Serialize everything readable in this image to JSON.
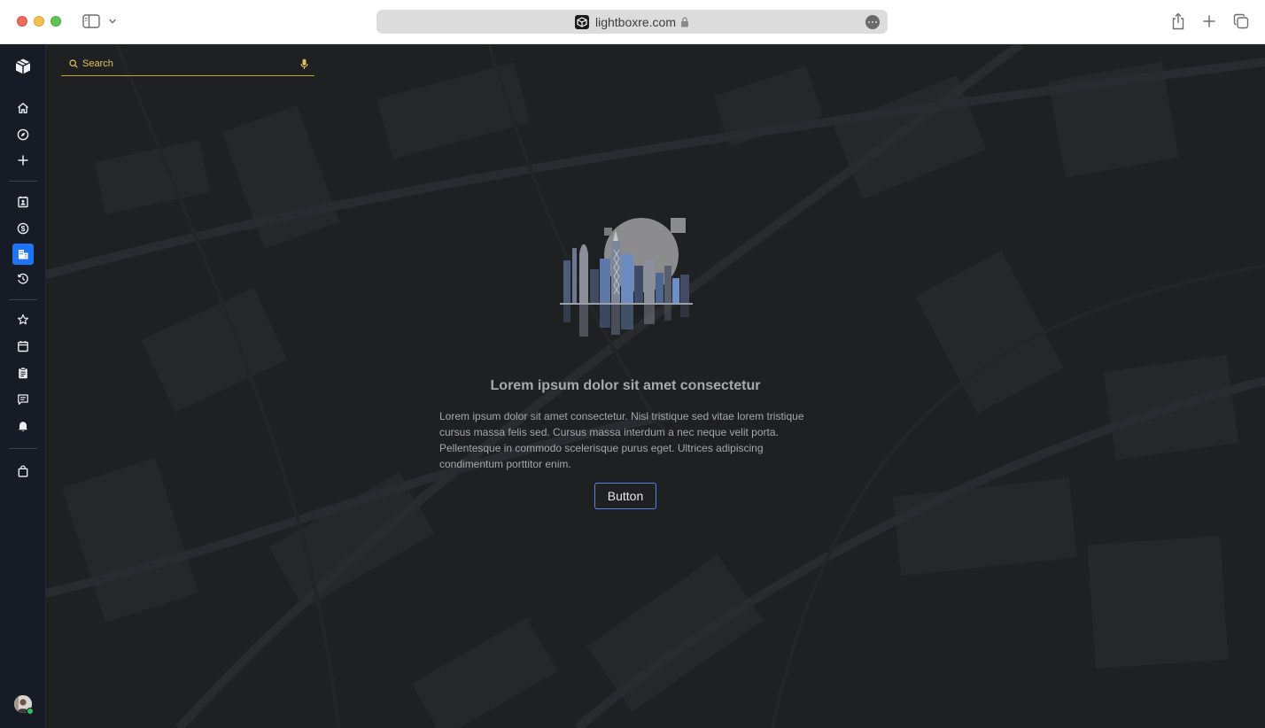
{
  "browser": {
    "url": "lightboxre.com"
  },
  "search": {
    "placeholder": "Search"
  },
  "sidebar": {
    "items": [
      {
        "icon": "home-icon"
      },
      {
        "icon": "compass-icon"
      },
      {
        "icon": "plus-icon"
      },
      {
        "icon": "contact-card-icon"
      },
      {
        "icon": "dollar-icon"
      },
      {
        "icon": "building-icon",
        "active": true
      },
      {
        "icon": "history-icon"
      },
      {
        "icon": "star-icon"
      },
      {
        "icon": "calendar-icon"
      },
      {
        "icon": "clipboard-icon"
      },
      {
        "icon": "chat-icon"
      },
      {
        "icon": "bell-icon"
      },
      {
        "icon": "shopping-bag-icon"
      }
    ]
  },
  "empty_state": {
    "title": "Lorem ipsum dolor sit amet consectetur",
    "body": "Lorem ipsum dolor sit amet consectetur. Nisl tristique sed vitae lorem tristique cursus massa felis sed. Cursus massa interdum a nec neque velit porta. Pellentesque in commodo scelerisque purus eget. Ultrices adipiscing condimentum porttitor enim.",
    "button_label": "Button"
  },
  "colors": {
    "accent_blue": "#1f74f4",
    "search_gold": "#c9a22c",
    "rail_bg": "#161b26",
    "main_bg": "#1f2022",
    "status_green": "#2ec260"
  }
}
